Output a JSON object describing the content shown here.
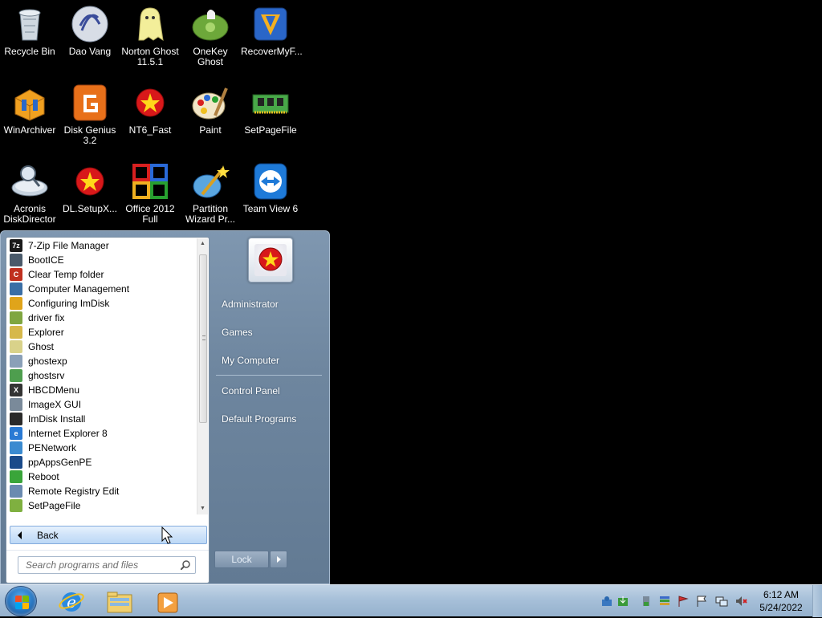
{
  "desktop": {
    "icons": [
      {
        "label": "Recycle Bin",
        "icon": "recycle-bin-icon"
      },
      {
        "label": "Dao Vang",
        "icon": "dao-vang-icon"
      },
      {
        "label": "Norton Ghost\n11.5.1",
        "icon": "ghost-icon"
      },
      {
        "label": "OneKey Ghost",
        "icon": "onekey-ghost-icon"
      },
      {
        "label": "RecoverMyF...",
        "icon": "boomerang-icon"
      },
      {
        "label": "WinArchiver",
        "icon": "archive-icon"
      },
      {
        "label": "Disk Genius\n3.2",
        "icon": "disk-genius-icon"
      },
      {
        "label": "NT6_Fast",
        "icon": "star-icon"
      },
      {
        "label": "Paint",
        "icon": "palette-icon"
      },
      {
        "label": "SetPageFile",
        "icon": "memory-card-icon"
      },
      {
        "label": "Acronis\nDiskDirector",
        "icon": "disk-director-icon"
      },
      {
        "label": "DL.SetupX...",
        "icon": "star-icon"
      },
      {
        "label": "Office 2012\nFull",
        "icon": "office-icon"
      },
      {
        "label": "Partition\nWizard Pr...",
        "icon": "wand-icon"
      },
      {
        "label": "Team View 6",
        "icon": "teamviewer-icon"
      }
    ]
  },
  "start_menu": {
    "programs": [
      {
        "label": "7-Zip File Manager",
        "color": "#1a1a1a",
        "glyph": "7z"
      },
      {
        "label": "BootICE",
        "color": "#4a5a6a",
        "glyph": ""
      },
      {
        "label": "Clear Temp folder",
        "color": "#c0301f",
        "glyph": "C"
      },
      {
        "label": "Computer Management",
        "color": "#3a6ea5",
        "glyph": ""
      },
      {
        "label": "Configuring ImDisk",
        "color": "#e0a41a",
        "glyph": ""
      },
      {
        "label": "driver fix",
        "color": "#7fa640",
        "glyph": ""
      },
      {
        "label": "Explorer",
        "color": "#d6b84a",
        "glyph": ""
      },
      {
        "label": "Ghost",
        "color": "#d9d28a",
        "glyph": ""
      },
      {
        "label": "ghostexp",
        "color": "#8aa0b8",
        "glyph": ""
      },
      {
        "label": "ghostsrv",
        "color": "#4e9e4e",
        "glyph": ""
      },
      {
        "label": "HBCDMenu",
        "color": "#333333",
        "glyph": "X"
      },
      {
        "label": "ImageX GUI",
        "color": "#7a8a9a",
        "glyph": ""
      },
      {
        "label": "ImDisk Install",
        "color": "#2a2a2a",
        "glyph": ""
      },
      {
        "label": "Internet Explorer 8",
        "color": "#2a7ad4",
        "glyph": "e"
      },
      {
        "label": "PENetwork",
        "color": "#3a8ad0",
        "glyph": ""
      },
      {
        "label": "ppAppsGenPE",
        "color": "#1a4a8a",
        "glyph": ""
      },
      {
        "label": "Reboot",
        "color": "#3aa53a",
        "glyph": ""
      },
      {
        "label": "Remote Registry Edit",
        "color": "#6a8ab0",
        "glyph": ""
      },
      {
        "label": "SetPageFile",
        "color": "#7fb040",
        "glyph": ""
      }
    ],
    "back_label": "Back",
    "search_placeholder": "Search programs and files",
    "right_items": [
      {
        "label": "Administrator",
        "name": "right-item-administrator"
      },
      {
        "label": "Games",
        "name": "right-item-games"
      },
      {
        "label": "My Computer",
        "name": "right-item-my-computer"
      },
      {
        "label": "Control Panel",
        "name": "right-item-control-panel"
      },
      {
        "label": "Default Programs",
        "name": "right-item-default-programs"
      }
    ],
    "lock_label": "Lock"
  },
  "taskbar": {
    "pinned": [
      "internet-explorer-icon",
      "file-explorer-icon",
      "media-player-icon"
    ],
    "tray_icons": [
      "network-share-icon",
      "download-icon",
      "usb-icon",
      "stack-icon",
      "flag-red-icon",
      "action-center-flag-icon",
      "network-icon",
      "volume-muted-icon"
    ],
    "time": "6:12 AM",
    "date": "5/24/2022"
  },
  "colors": {
    "desktop_background": "#000000",
    "start_menu_accent": "#6e869f",
    "taskbar": "#a7c0d9"
  }
}
